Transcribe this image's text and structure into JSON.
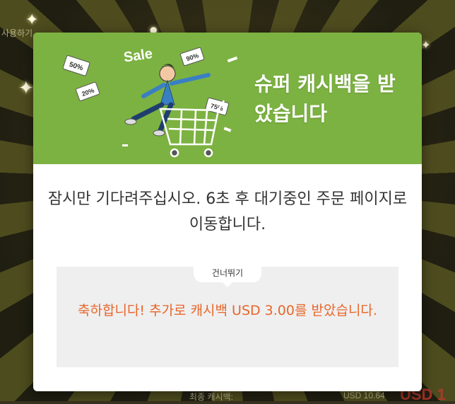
{
  "background": {
    "top_left_text": "사용하기",
    "bottom_label": "최종 캐시백:",
    "bottom_amount": "USD 10.64",
    "bottom_big": "USD 1"
  },
  "modal": {
    "title": "슈퍼 캐시백을 받았습니다",
    "illustration": {
      "sale_label": "Sale",
      "tags": [
        "50%",
        "90%",
        "20%",
        "75%"
      ]
    },
    "message": "잠시만 기다려주십시오. 6초 후 대기중인 주문 페이지로 이동합니다.",
    "skip_label": "건너뛰기",
    "bonus_message": "축하합니다! 추가로 캐시백 USD 3.00를 받았습니다."
  },
  "colors": {
    "header_green": "#7cb241",
    "bonus_orange": "#e8662a",
    "overlay": "#3a3320"
  }
}
